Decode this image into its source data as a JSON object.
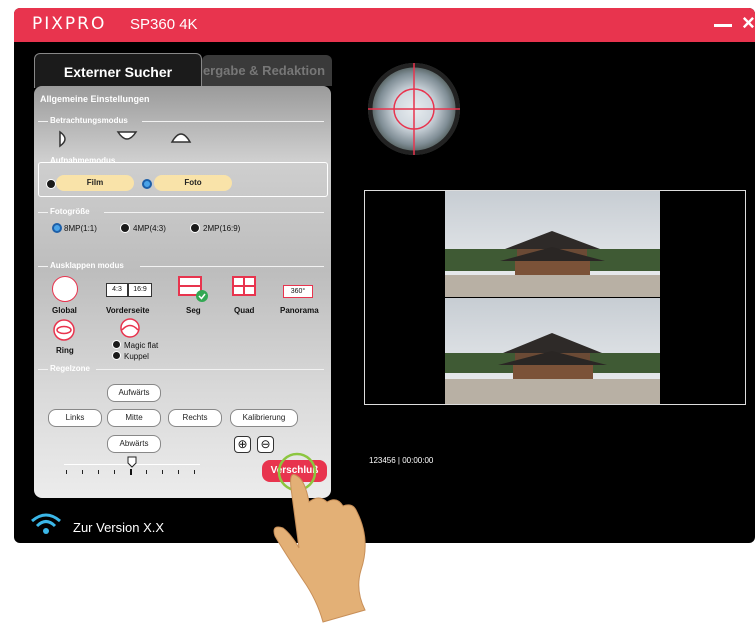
{
  "app": {
    "brand": "PIXPRO",
    "model": "SP360 4K"
  },
  "tabs": {
    "active": "Externer Sucher",
    "inactive": "Wiedergabe & Redaktion"
  },
  "settings": {
    "title": "Allgemeine Einstellungen",
    "viewing_mode": "Betrachtungsmodus",
    "capture_mode": {
      "title": "Aufnahmemodus",
      "film": "Film",
      "photo": "Foto",
      "selected": "Foto"
    },
    "photo_size": {
      "title": "Fotogröße",
      "options": [
        "8MP(1:1)",
        "4MP(4:3)",
        "2MP(16:9)"
      ],
      "selected": "8MP(1:1)"
    },
    "unfold": {
      "title": "Ausklappen modus",
      "global": "Global",
      "front": "Vorderseite",
      "ratio_a": "4:3",
      "ratio_b": "16:9",
      "seg": "Seg",
      "quad": "Quad",
      "panorama": "Panorama",
      "panorama_icon": "360°",
      "ring": "Ring",
      "magic_flat": "Magic flat",
      "dome": "Kuppel",
      "selected": "Seg"
    },
    "control": {
      "title": "Regelzone",
      "up": "Aufwärts",
      "left": "Links",
      "center": "Mitte",
      "right": "Rechts",
      "down": "Abwärts",
      "calibrate": "Kalibrierung",
      "shutter": "Verschluß"
    }
  },
  "status": {
    "timecode": "123456 | 00:00:00"
  },
  "footer": {
    "version": "Zur Version X.X"
  },
  "colors": {
    "brand": "#e8344e",
    "accent": "#4aa3e8",
    "pill": "#f9e3a9"
  }
}
